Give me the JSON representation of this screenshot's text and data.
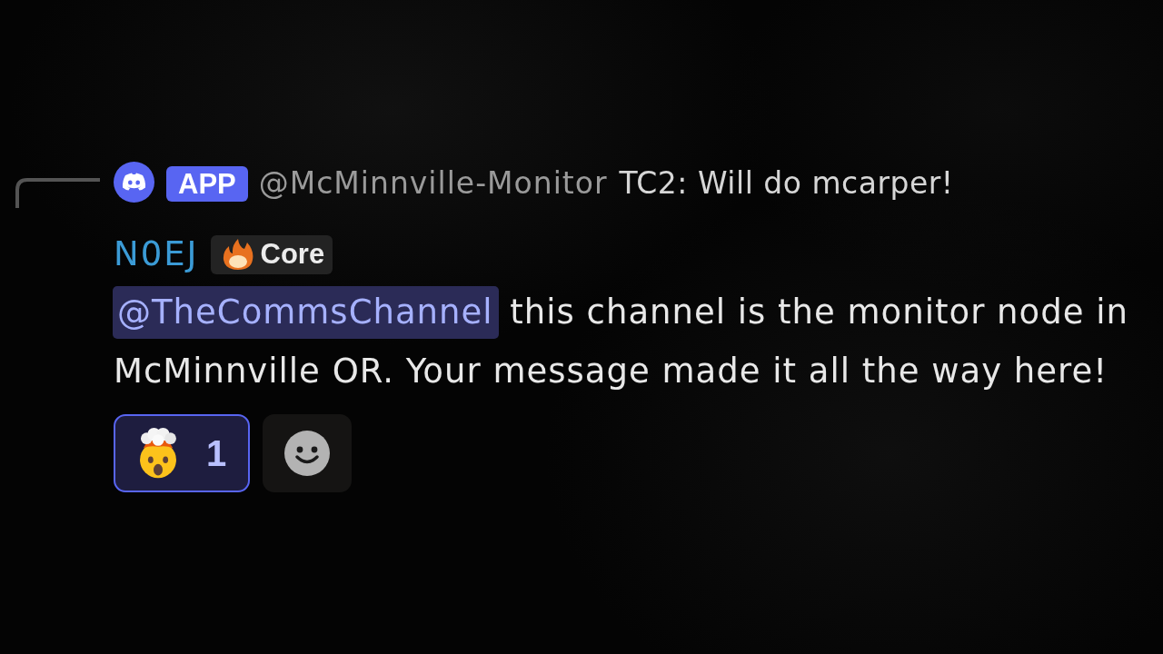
{
  "reply": {
    "badge": "APP",
    "author": "@McMinnville-Monitor",
    "text": "TC2: Will do mcarper!"
  },
  "message": {
    "author": "N0EJ",
    "tag": {
      "label": "Core"
    },
    "mention": "@TheCommsChannel",
    "text": "this channel is the monitor node in McMinnville OR. Your message made it all the way here!"
  },
  "reactions": [
    {
      "count": "1",
      "selected": true
    }
  ]
}
